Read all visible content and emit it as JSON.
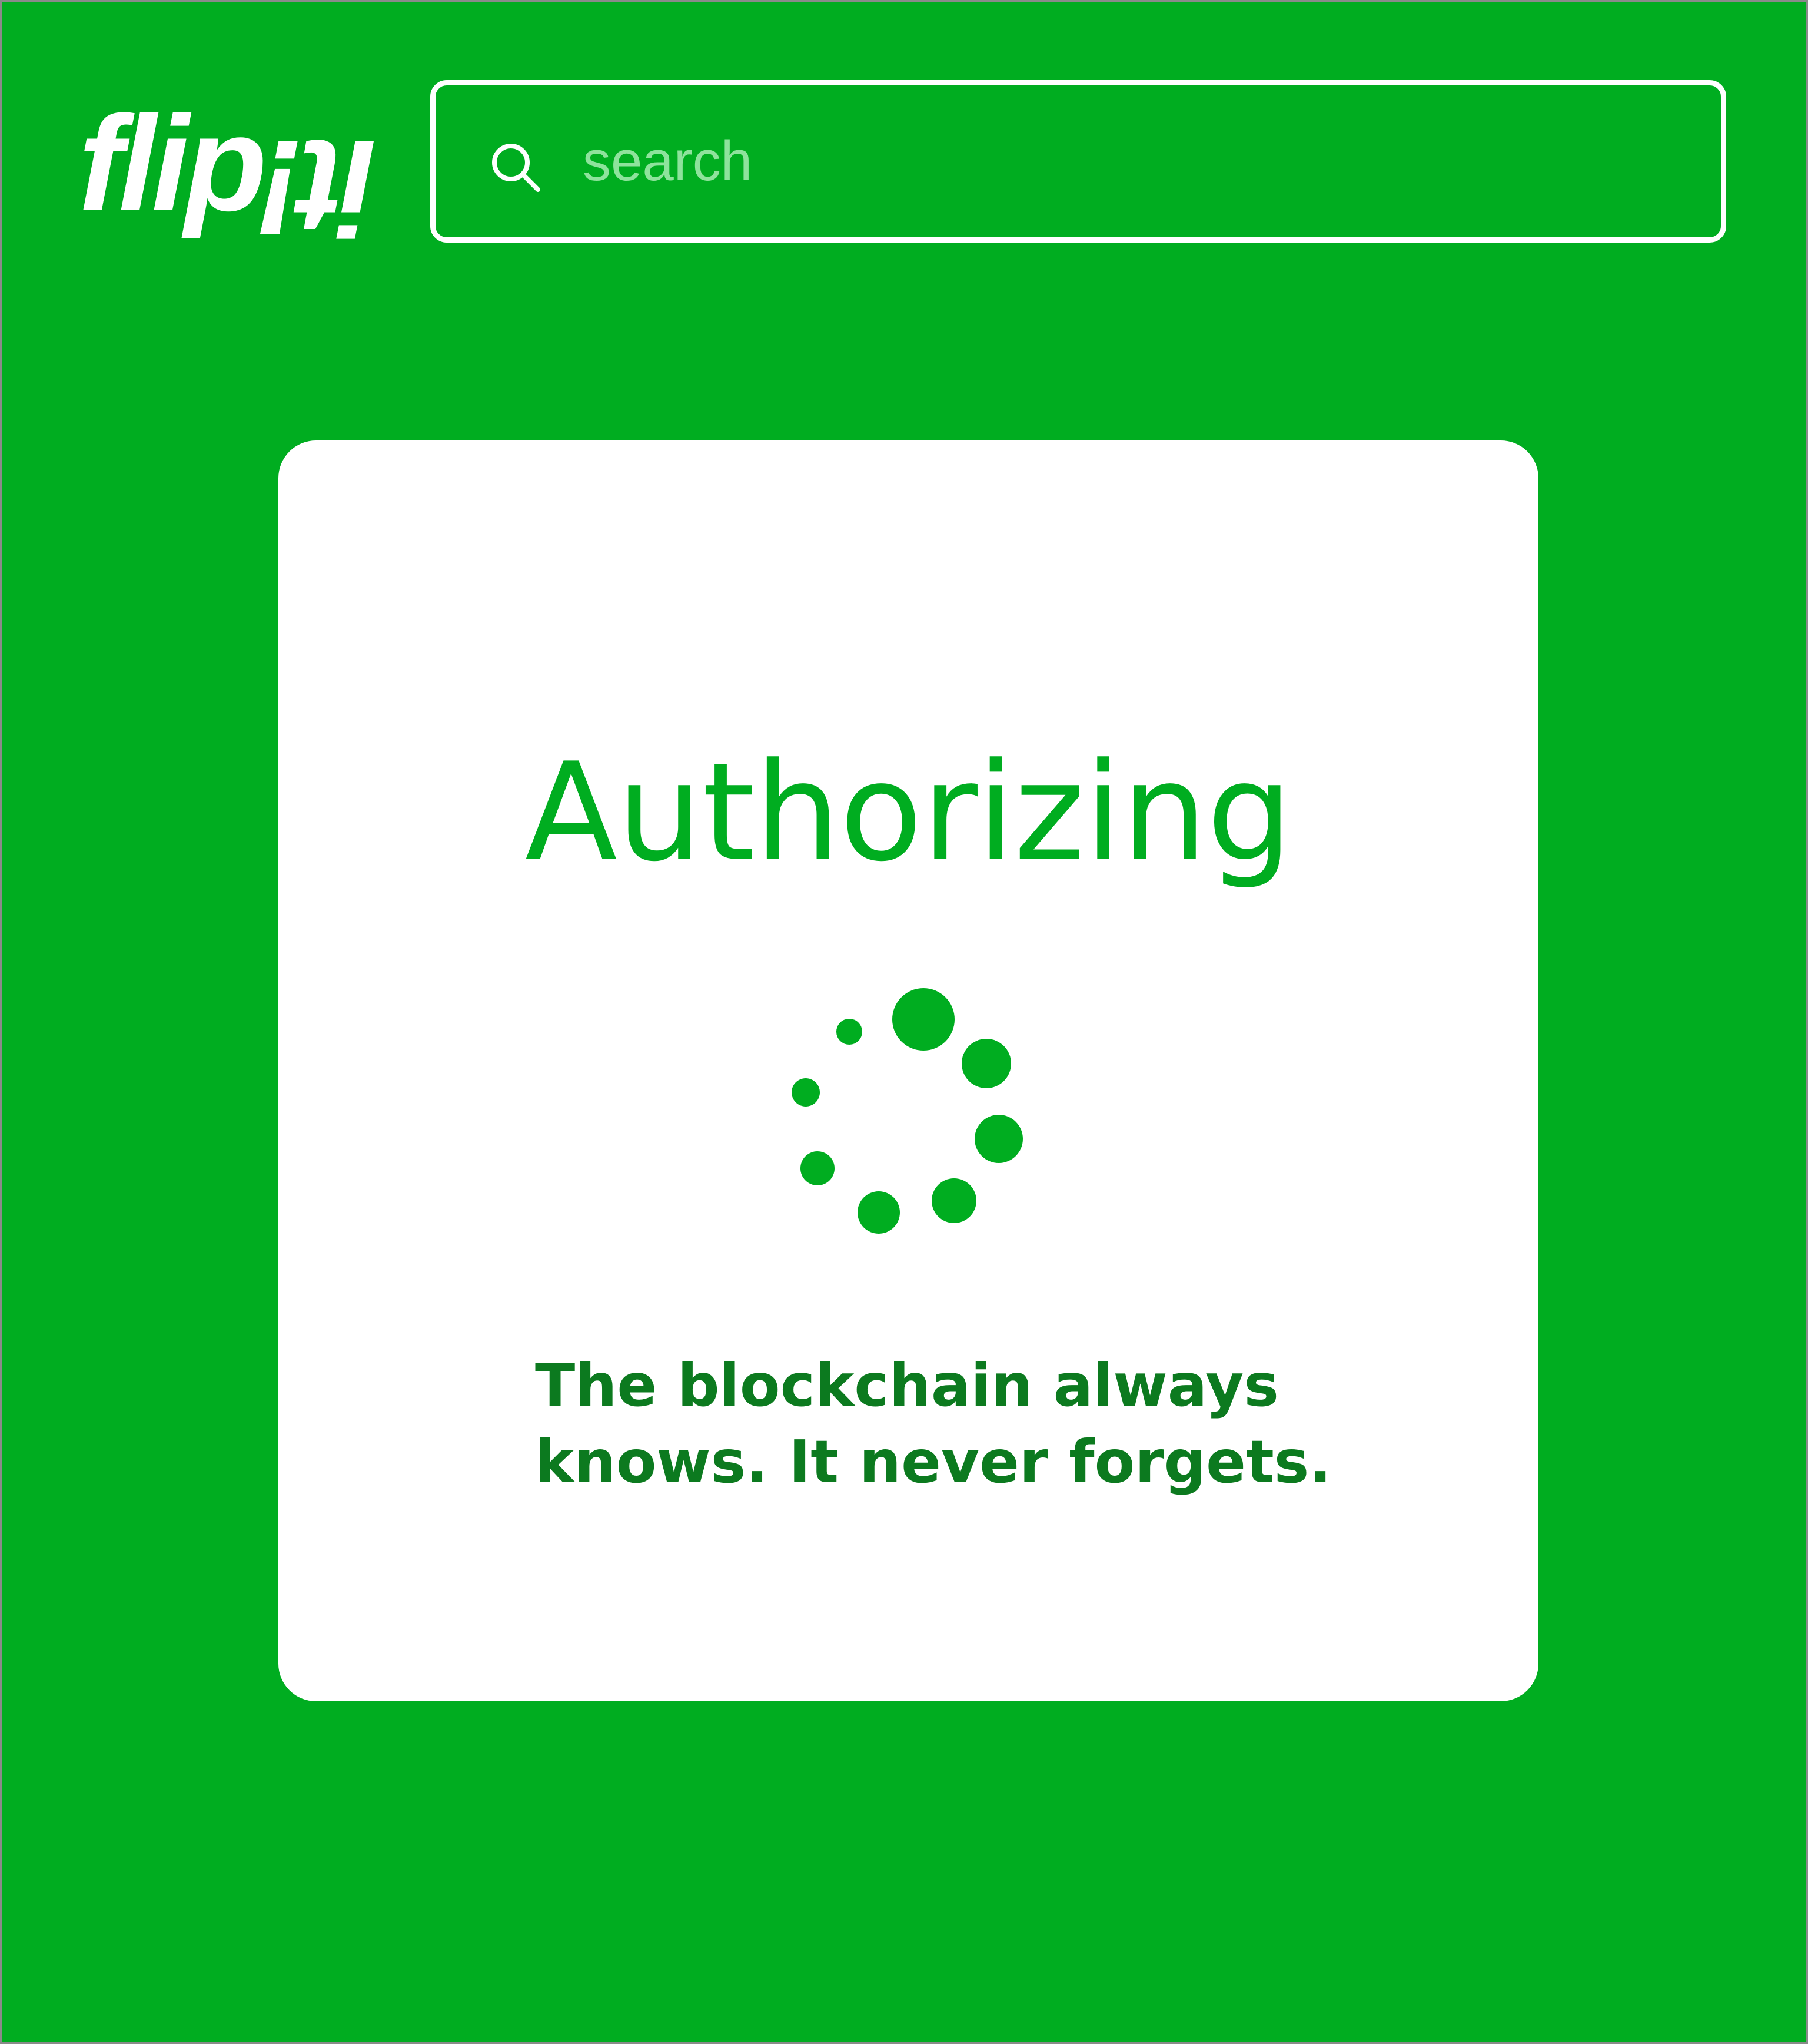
{
  "app": {
    "name": "flipit!",
    "background_color": "#00ad20"
  },
  "header": {
    "logo": {
      "part_upright": "flip",
      "part_flipped": "it!",
      "color": "#ffffff"
    },
    "search": {
      "placeholder": "search",
      "value": "",
      "icon": "search-icon",
      "border_color": "#ffffff",
      "placeholder_color": "#8ee39c"
    }
  },
  "modal": {
    "title": "Authorizing",
    "message": "The blockchain always knows. It never forgets.",
    "status": "loading",
    "spinner_icon": "loading-spinner-icon",
    "title_color": "#00ad20",
    "message_color": "#0c7a1f",
    "spinner_color": "#00ad20"
  }
}
